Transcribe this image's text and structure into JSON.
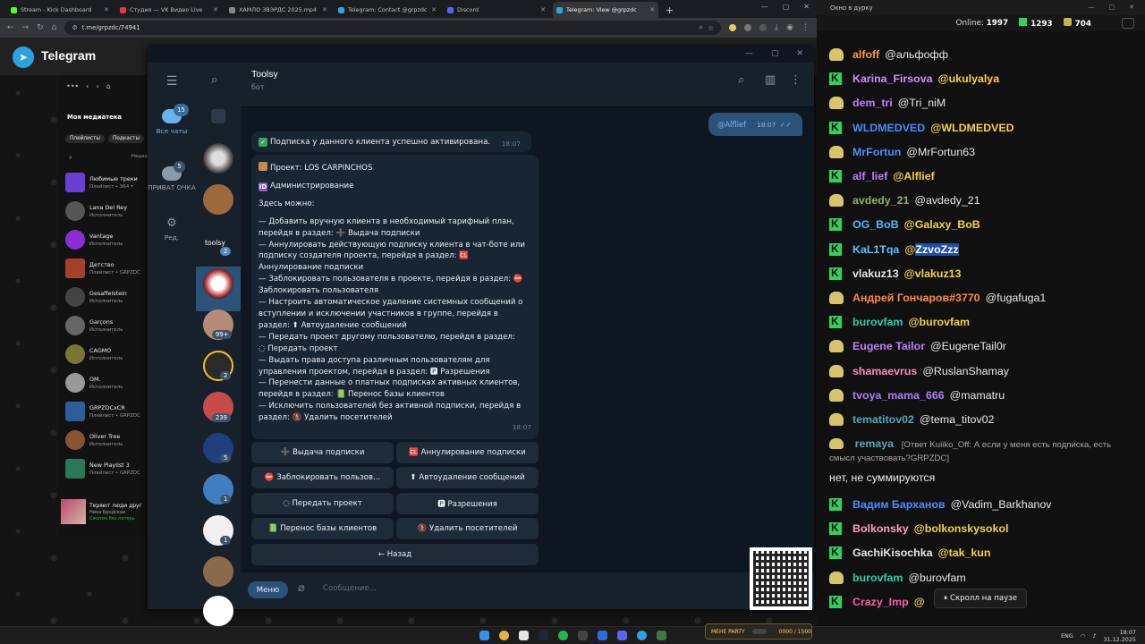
{
  "browser": {
    "tabs": [
      {
        "label": "Stream - Kick Dashboard",
        "color": "#53fc18"
      },
      {
        "label": "Студия — VK Видео Live",
        "color": "#e5373d"
      },
      {
        "label": "ХАМЛО ЗВЭРДС 2025.mp4",
        "color": "#888888"
      },
      {
        "label": "Telegram: Contact @grpzdc",
        "color": "#2aa3df"
      },
      {
        "label": "Discord",
        "color": "#5865f2"
      },
      {
        "label": "Telegram: View @grpzdc",
        "color": "#2aa3df"
      }
    ],
    "url": "t.me/grpzdc/74941"
  },
  "web_header": {
    "title": "Telegram"
  },
  "spotify": {
    "library_title": "Моя медиатека",
    "filters": [
      "Плейлисты",
      "Подкасты"
    ],
    "search_hint": "Недав",
    "items": [
      {
        "title": "Любимые треки",
        "sub": "Плейлист • 364 т",
        "pinned": true
      },
      {
        "title": "Lana Del Rey",
        "sub": "Исполнитель"
      },
      {
        "title": "Vantage",
        "sub": "Исполнитель"
      },
      {
        "title": "Детство",
        "sub": "Плейлист • GRPZDC"
      },
      {
        "title": "Gesaffelstein",
        "sub": "Исполнитель"
      },
      {
        "title": "Garçons",
        "sub": "Исполнитель"
      },
      {
        "title": "CAGMO",
        "sub": "Исполнитель"
      },
      {
        "title": "OM.",
        "sub": "Исполнитель"
      },
      {
        "title": "GRPZDCxCR",
        "sub": "Плейлист • GRPZDC"
      },
      {
        "title": "Oliver Tree",
        "sub": "Исполнитель"
      },
      {
        "title": "New Playlist 3",
        "sub": "Плейлист • GRPZDC"
      }
    ],
    "now_playing": {
      "title": "Теряют люди друг",
      "artist": "Нина Бродская",
      "status": "Сжатие без потерь"
    }
  },
  "telegram": {
    "folders": [
      {
        "label": "Все чаты",
        "badge": "15"
      },
      {
        "label": "ПРИВАТ ОЧКА",
        "badge": "5"
      },
      {
        "label": "Ред."
      }
    ],
    "chat_badges": {
      "toolsy": "2",
      "c6": "99+",
      "c7": "2",
      "c8": "239",
      "c9": "5",
      "c10": "1",
      "c11": "1"
    },
    "selected_chat_label": "toolsy",
    "chat": {
      "name": "Toolsy",
      "status": "бот"
    },
    "out_msg": {
      "text": "@Alflief",
      "time": "18:07"
    },
    "msg1": {
      "text": "Подписка у данного клиента успешно активирована.",
      "time": "18:07"
    },
    "msg2": {
      "project": "Проект: LOS CARPINCHOS",
      "admin": "Администрирование",
      "intro": "Здесь можно:",
      "lines": [
        "— Добавить вручную клиента в необходимый тарифный план,",
        "перейдя в раздел: ➕ Выдача подписки",
        "— Аннулировать действующую подписку клиента в чат-боте или",
        "подписку создателя проекта, перейдя в раздел: 🆑",
        "Аннулирование подписки",
        "— Заблокировать пользователя в проекте, перейдя в раздел: ⛔",
        "Заблокировать пользователя",
        "— Настроить автоматическое удаление системных сообщений о",
        "вступлении и исключении участников в группе, перейдя в",
        "раздел: ⬆ Автоудаление сообщений",
        "— Передать проект другому пользователю, перейдя в раздел:",
        "◌ Передать проект",
        "— Выдать права доступа различным пользователям для",
        "управления проектом, перейдя в раздел: 🅿 Разрешения",
        "— Перенести данные о платных подписках активных клиентов,",
        "перейдя в раздел: 📗 Перенос базы клиентов",
        "— Исключить пользователей без активной подписки, перейдя в",
        "раздел: 🚷 Удалить посетителей"
      ],
      "time": "18:07"
    },
    "buttons": [
      "➕ Выдача подписки",
      "🆑 Аннулирование подписки",
      "⛔ Заблокировать пользов...",
      "⬆ Автоудаление сообщений",
      "◌ Передать проект",
      "🅿 Разрешения",
      "📗 Перенос базы клиентов",
      "🚷 Удалить посетителей",
      "← Назад"
    ],
    "input": {
      "menu": "Меню",
      "placeholder": "Сообщение..."
    }
  },
  "side_chat": {
    "window_title": "Окно в дурку",
    "online_label": "Online:",
    "online": "1997",
    "kick_count": "1293",
    "other_count": "704",
    "messages": [
      {
        "src": "vk",
        "user": "alfoff",
        "color": "#ff9a3c",
        "text": "@альфофф",
        "hl": false
      },
      {
        "src": "kick",
        "user": "Karina_Firsova",
        "color": "#d08cff",
        "text": "@ukulyalya",
        "hl": true
      },
      {
        "src": "vk",
        "user": "dem_tri",
        "color": "#c27cff",
        "text": "@Tri_niM",
        "hl": false
      },
      {
        "src": "kick",
        "user": "WLDMEDVED",
        "color": "#3f8cff",
        "text": "@WLDMEDVED",
        "hl": true
      },
      {
        "src": "vk",
        "user": "MrFortun",
        "color": "#4a8dff",
        "text": "@MrFortun63",
        "hl": false
      },
      {
        "src": "kick",
        "user": "alf_lief",
        "color": "#c27cff",
        "text": "@Alflief",
        "hl": true
      },
      {
        "src": "vk",
        "user": "avdedy_21",
        "color": "#8fae6a",
        "text": "@avdedy_21",
        "hl": false
      },
      {
        "src": "kick",
        "user": "OG_BoB",
        "color": "#4fb8ff",
        "text": "@Galaxy_BoB",
        "hl": true
      },
      {
        "src": "kick",
        "user": "KaL1Tqa",
        "color": "#4fc7ff",
        "text": "@ZzvoZzz",
        "hl": true,
        "sel": true
      },
      {
        "src": "kick",
        "user": "vlakuz13",
        "color": "#e6e6e6",
        "text": "@vlakuz13",
        "hl": true
      },
      {
        "src": "vk",
        "user": "Андрей Гончаров#3770",
        "color": "#ff8a3c",
        "text": "@fugafuga1",
        "hl": false
      },
      {
        "src": "kick",
        "user": "burovfam",
        "color": "#29d0b0",
        "text": "@burovfam",
        "hl": true
      },
      {
        "src": "vk",
        "user": "Eugene Tailor",
        "color": "#c27cff",
        "text": "@EugeneTail0r",
        "hl": false
      },
      {
        "src": "vk",
        "user": "shamaevrus",
        "color": "#ff8ac0",
        "text": "@RuslanShamay",
        "hl": false
      },
      {
        "src": "vk",
        "user": "tvoya_mama_666",
        "color": "#b07cff",
        "text": "@mamatru",
        "hl": false
      },
      {
        "src": "vk",
        "user": "tematitov02",
        "color": "#4fa9bd",
        "text": "@tema_titov02",
        "hl": false
      }
    ],
    "reply": {
      "user": "remaya",
      "text": "[Ответ Kuiiko_Off: А если у меня есть подписка, есть смысл участвовать?GRPZDC]",
      "answer": "нет, не суммируются"
    },
    "messages2": [
      {
        "src": "kick",
        "user": "Вадим Барханов",
        "color": "#4a8dff",
        "text": "@Vadim_Barkhanov",
        "hl": false
      },
      {
        "src": "kick",
        "user": "Bolkonsky",
        "color": "#ff9ec0",
        "text": "@bolkonskysokol",
        "hl": true
      },
      {
        "src": "kick",
        "user": "GachiKisochka",
        "color": "#e6e6e6",
        "text": "@tak_kun",
        "hl": true
      },
      {
        "src": "vk",
        "user": "burovfam",
        "color": "#29d0b0",
        "text": "@burovfam",
        "hl": false
      },
      {
        "src": "kick",
        "user": "Crazy_Imp",
        "color": "#ff5ca8",
        "text": "@",
        "hl": true
      }
    ],
    "pause_label": "⏸ Скролл на паузе"
  },
  "taskbar": {
    "lang": "ENG",
    "time": "18:07",
    "date": "31.12.2025",
    "party_label": "МЕНЕ PARTY",
    "party_count": "0000 / 1500"
  }
}
